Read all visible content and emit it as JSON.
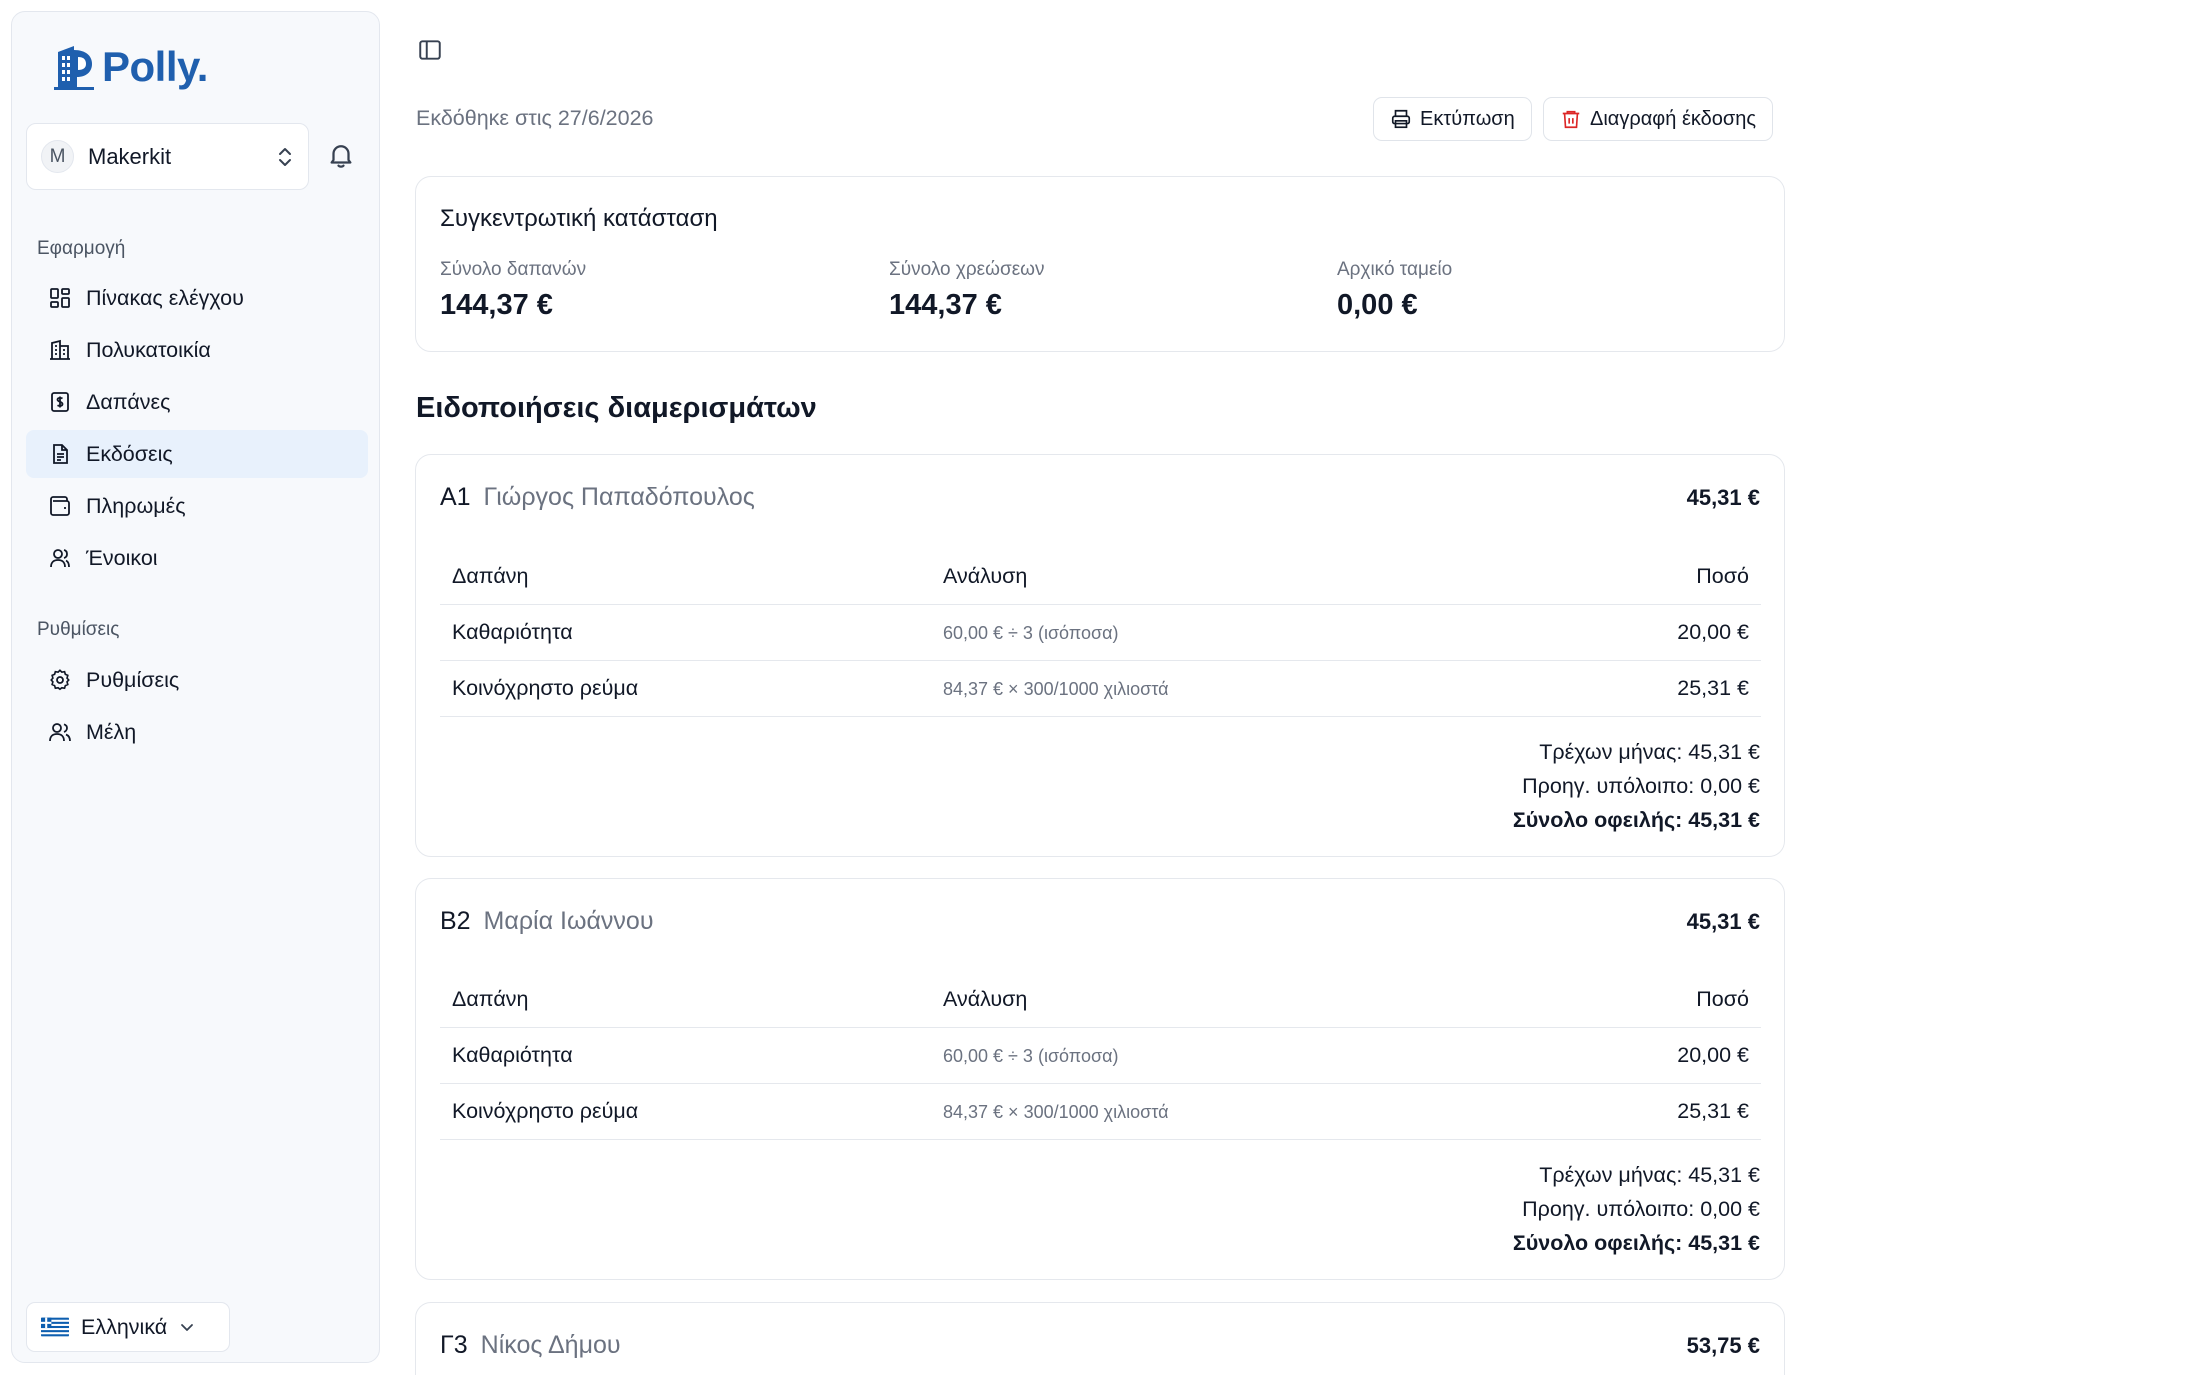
{
  "app": {
    "logo_text": "Polly.",
    "brand_color": "#1f5fae"
  },
  "account": {
    "initial": "M",
    "name": "Makerkit"
  },
  "sidebar": {
    "section_app": "Εφαρμογή",
    "items": [
      {
        "label": "Πίνακας ελέγχου",
        "icon": "dashboard-icon"
      },
      {
        "label": "Πολυκατοικία",
        "icon": "building-icon"
      },
      {
        "label": "Δαπάνες",
        "icon": "receipt-icon"
      },
      {
        "label": "Εκδόσεις",
        "icon": "document-icon",
        "active": true
      },
      {
        "label": "Πληρωμές",
        "icon": "wallet-icon"
      },
      {
        "label": "Ένοικοι",
        "icon": "users-icon"
      }
    ],
    "section_settings": "Ρυθμίσεις",
    "settings_items": [
      {
        "label": "Ρυθμίσεις",
        "icon": "gear-icon"
      },
      {
        "label": "Μέλη",
        "icon": "members-icon"
      }
    ],
    "language": "Ελληνικά"
  },
  "header": {
    "issued": "Εκδόθηκε στις 27/6/2026",
    "print_label": "Εκτύπωση",
    "delete_label": "Διαγραφή έκδοσης"
  },
  "summary": {
    "title": "Συγκεντρωτική κατάσταση",
    "expenses_label": "Σύνολο δαπανών",
    "expenses_value": "144,37 €",
    "charges_label": "Σύνολο χρεώσεων",
    "charges_value": "144,37 €",
    "fund_label": "Αρχικό ταμείο",
    "fund_value": "0,00 €"
  },
  "notices_title": "Ειδοποιήσεις διαμερισμάτων",
  "table_headers": {
    "expense": "Δαπάνη",
    "analysis": "Ανάλυση",
    "amount": "Ποσό"
  },
  "apartments": [
    {
      "code": "Α1",
      "name": "Γιώργος Παπαδόπουλος",
      "total": "45,31 €",
      "rows": [
        {
          "expense": "Καθαριότητα",
          "analysis": "60,00 € ÷ 3 (ισόποσα)",
          "amount": "20,00 €"
        },
        {
          "expense": "Κοινόχρηστο ρεύμα",
          "analysis": "84,37 € × 300/1000 χιλιοστά",
          "amount": "25,31 €"
        }
      ],
      "current": "Τρέχων μήνας: 45,31 €",
      "previous": "Προηγ. υπόλοιπο: 0,00 €",
      "due": "Σύνολο οφειλής: 45,31 €"
    },
    {
      "code": "Β2",
      "name": "Μαρία Ιωάννου",
      "total": "45,31 €",
      "rows": [
        {
          "expense": "Καθαριότητα",
          "analysis": "60,00 € ÷ 3 (ισόποσα)",
          "amount": "20,00 €"
        },
        {
          "expense": "Κοινόχρηστο ρεύμα",
          "analysis": "84,37 € × 300/1000 χιλιοστά",
          "amount": "25,31 €"
        }
      ],
      "current": "Τρέχων μήνας: 45,31 €",
      "previous": "Προηγ. υπόλοιπο: 0,00 €",
      "due": "Σύνολο οφειλής: 45,31 €"
    },
    {
      "code": "Γ3",
      "name": "Νίκος Δήμου",
      "total": "53,75 €"
    }
  ]
}
